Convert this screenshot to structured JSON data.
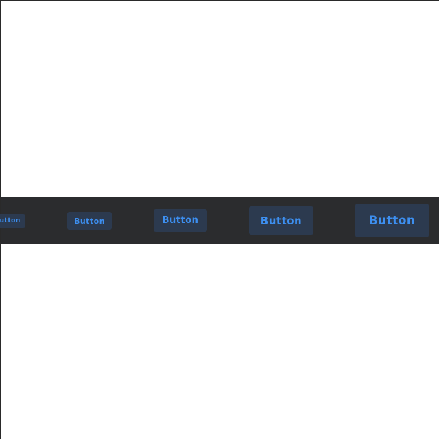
{
  "colors": {
    "page_background": "#ffffff",
    "strip_background": "#2b2c2e",
    "button_background": "#2c3a4f",
    "button_text": "#3d8ff0"
  },
  "buttons": [
    {
      "label": "Button",
      "size": "extra-small"
    },
    {
      "label": "Button",
      "size": "small"
    },
    {
      "label": "Button",
      "size": "medium"
    },
    {
      "label": "Button",
      "size": "large"
    },
    {
      "label": "Button",
      "size": "extra-large"
    }
  ]
}
